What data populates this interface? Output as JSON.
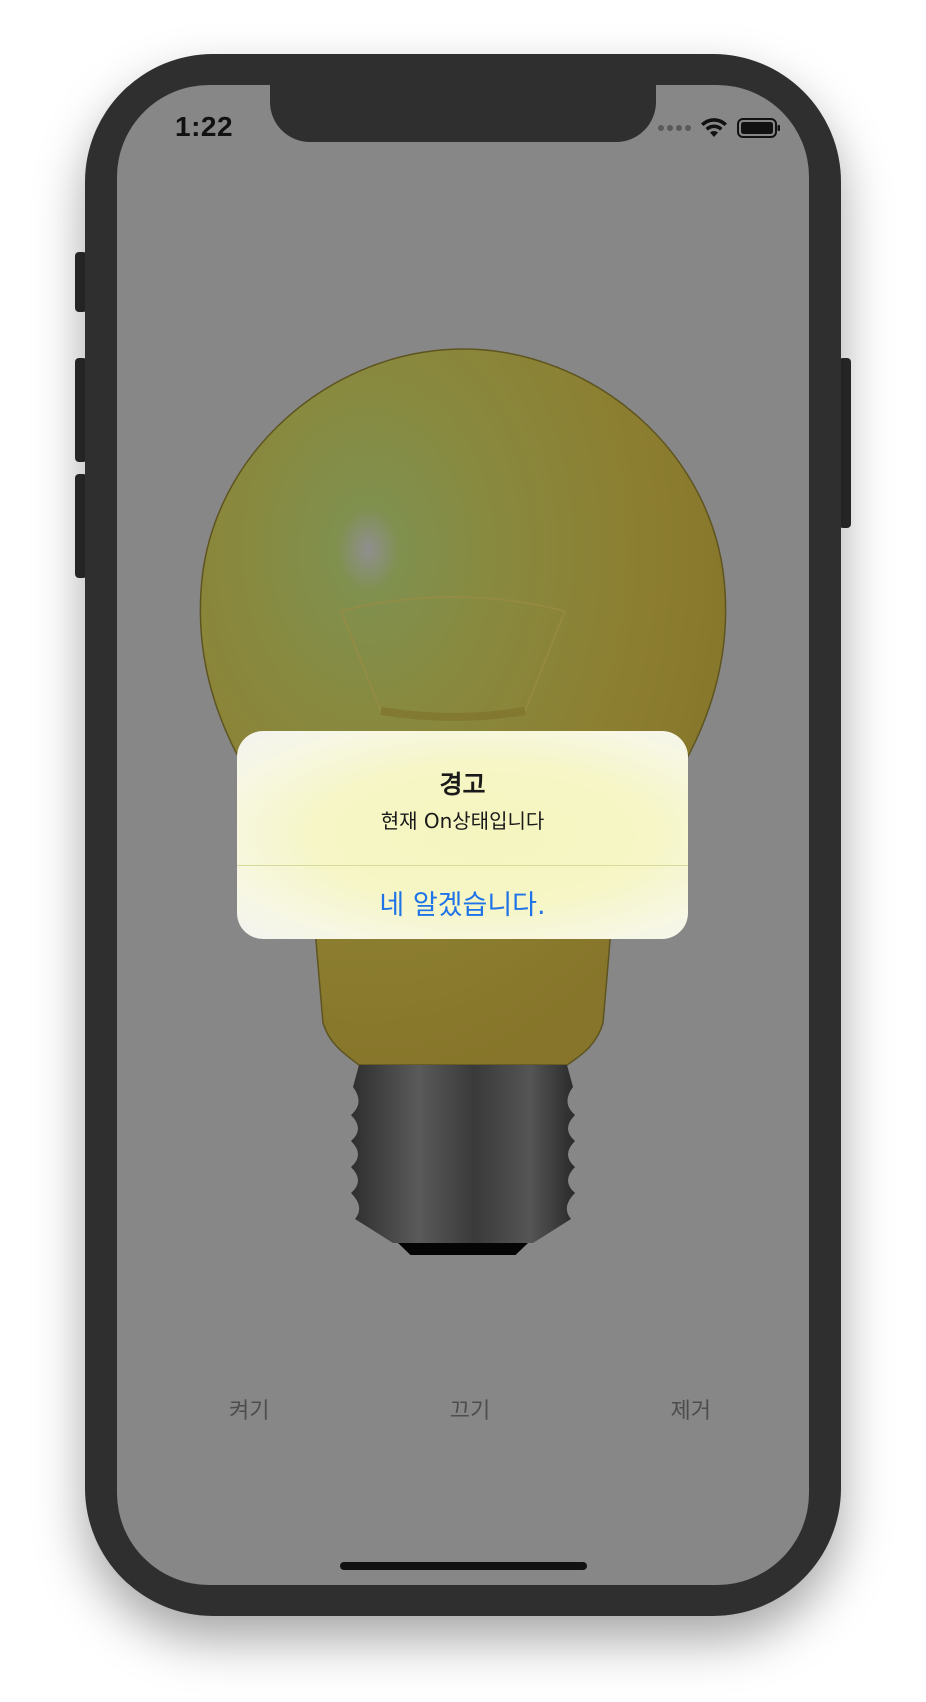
{
  "status_bar": {
    "time": "1:22"
  },
  "alert": {
    "title": "경고",
    "message": "현재 On상태입니다",
    "action_label": "네 알겠습니다.",
    "action_color": "#1e73e8"
  },
  "toolbar": {
    "on_label": "켜기",
    "off_label": "끄기",
    "remove_label": "제거"
  },
  "colors": {
    "screen_dim": "#878787",
    "bulb_glass": "#8a7a2e",
    "device_frame": "#2f2f2f"
  }
}
